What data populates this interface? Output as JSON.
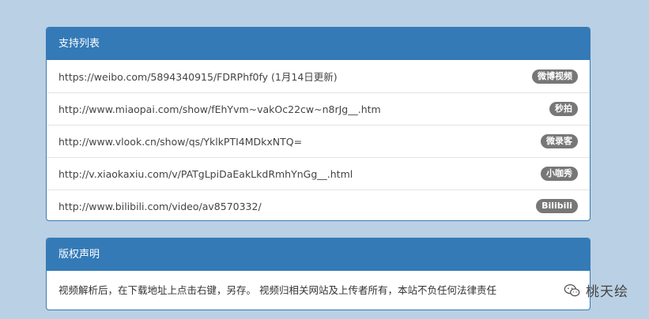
{
  "support_panel": {
    "title": "支持列表",
    "items": [
      {
        "url": "https://weibo.com/5894340915/FDRPhf0fy (1月14日更新)",
        "badge": "微博视频"
      },
      {
        "url": "http://www.miaopai.com/show/fEhYvm~vakOc22cw~n8rJg__.htm",
        "badge": "秒拍"
      },
      {
        "url": "http://www.vlook.cn/show/qs/YklkPTI4MDkxNTQ=",
        "badge": "微录客"
      },
      {
        "url": "http://v.xiaokaxiu.com/v/PATgLpiDaEakLkdRmhYnGg__.html",
        "badge": "小咖秀"
      },
      {
        "url": "http://www.bilibili.com/video/av8570332/",
        "badge": "Bilibili"
      }
    ]
  },
  "copyright_panel": {
    "title": "版权声明",
    "body": "视频解析后，在下载地址上点击右键，另存。 视频归相关网站及上传者所有，本站不负任何法律责任"
  },
  "watermark": {
    "icon": "wechat-icon",
    "text": "桃天绘"
  }
}
